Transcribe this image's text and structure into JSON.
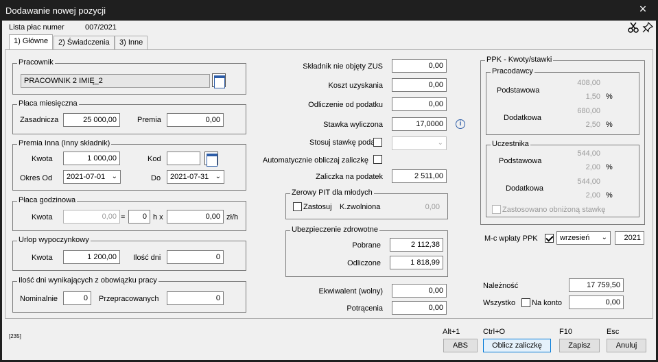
{
  "window": {
    "title": "Dodawanie nowej pozycji",
    "close_icon": "×"
  },
  "header": {
    "lista_label": "Lista płac numer",
    "lista_number": "007/2021"
  },
  "tabs": [
    "1) Główne",
    "2) Świadczenia",
    "3) Inne"
  ],
  "pracownik": {
    "legend": "Pracownik",
    "value": "PRACOWNIK 2 IMIĘ_2"
  },
  "placa_miesieczna": {
    "legend": "Płaca miesięczna",
    "zasadnicza_label": "Zasadnicza",
    "zasadnicza": "25 000,00",
    "premia_label": "Premia",
    "premia": "0,00"
  },
  "premia_inna": {
    "legend": "Premia Inna (Inny składnik)",
    "kwota_label": "Kwota",
    "kwota": "1 000,00",
    "kod_label": "Kod",
    "kod": "",
    "okres_label": "Okres  Od",
    "od": "2021-07-01",
    "do_label": "Do",
    "do": "2021-07-31"
  },
  "placa_godzinowa": {
    "legend": "Płaca godzinowa",
    "kwota_label": "Kwota",
    "kwota": "0,00",
    "eq": "=",
    "hours": "0",
    "hx": "h x",
    "rate": "0,00",
    "unit": "zł/h"
  },
  "urlop": {
    "legend": "Urlop wypoczynkowy",
    "kwota_label": "Kwota",
    "kwota": "1 200,00",
    "ilosc_label": "Ilość dni",
    "ilosc": "0"
  },
  "ilosc_dni": {
    "legend": "Ilość dni wynikających z obowiązku pracy",
    "nominalnie_label": "Nominalnie",
    "nominalnie": "0",
    "przepracowanych_label": "Przepracowanych",
    "przepracowanych": "0"
  },
  "middle": {
    "skladnik_label": "Składnik nie objęty ZUS",
    "skladnik": "0,00",
    "koszt_label": "Koszt uzyskania",
    "koszt": "0,00",
    "odliczenie_label": "Odliczenie od podatku",
    "odliczenie": "0,00",
    "stawka_label": "Stawka wyliczona",
    "stawka": "17,0000",
    "stosuj_label": "Stosuj stawkę podatk.",
    "auto_label": "Automatycznie obliczaj zaliczkę",
    "zaliczka_label": "Zaliczka na podatek",
    "zaliczka": "2 511,00"
  },
  "zerowy_pit": {
    "legend": "Zerowy PIT dla młodych",
    "zastosuj_label": "Zastosuj",
    "kzw_label": "K.zwolniona",
    "kzw": "0,00"
  },
  "ubezpieczenie": {
    "legend": "Ubezpieczenie zdrowotne",
    "pobrane_label": "Pobrane",
    "pobrane": "2 112,38",
    "odliczone_label": "Odliczone",
    "odliczone": "1 818,99"
  },
  "ekwiwalent": {
    "label": "Ekwiwalent (wolny)",
    "value": "0,00",
    "potracenia_label": "Potrącenia",
    "potracenia": "0,00"
  },
  "ppk": {
    "legend": "PPK - Kwoty/stawki",
    "pracodawcy": {
      "legend": "Pracodawcy",
      "podst_label": "Podstawowa",
      "podst_kwota": "408,00",
      "podst_pct": "1,50",
      "dod_label": "Dodatkowa",
      "dod_kwota": "680,00",
      "dod_pct": "2,50",
      "pct": "%"
    },
    "uczestnika": {
      "legend": "Uczestnika",
      "podst_label": "Podstawowa",
      "podst_kwota": "544,00",
      "podst_pct": "2,00",
      "dod_label": "Dodatkowa",
      "dod_kwota": "544,00",
      "dod_pct": "2,00",
      "pct": "%"
    },
    "obnizona_label": "Zastosowano obniżoną stawkę"
  },
  "mc_wplaty": {
    "label": "M-c wpłaty  PPK",
    "month": "wrzesień",
    "year": "2021"
  },
  "naleznosc": {
    "label": "Należność",
    "value": "17 759,50",
    "wszystko_label": "Wszystko",
    "na_konto_label": "Na konto",
    "na_konto": "0,00"
  },
  "footer": {
    "code": "[235]"
  },
  "buttons": [
    {
      "shortcut": "Alt+1",
      "label": "ABS"
    },
    {
      "shortcut": "Ctrl+O",
      "label": "Oblicz zaliczkę"
    },
    {
      "shortcut": "F10",
      "label": "Zapisz"
    },
    {
      "shortcut": "Esc",
      "label": "Anuluj"
    }
  ]
}
